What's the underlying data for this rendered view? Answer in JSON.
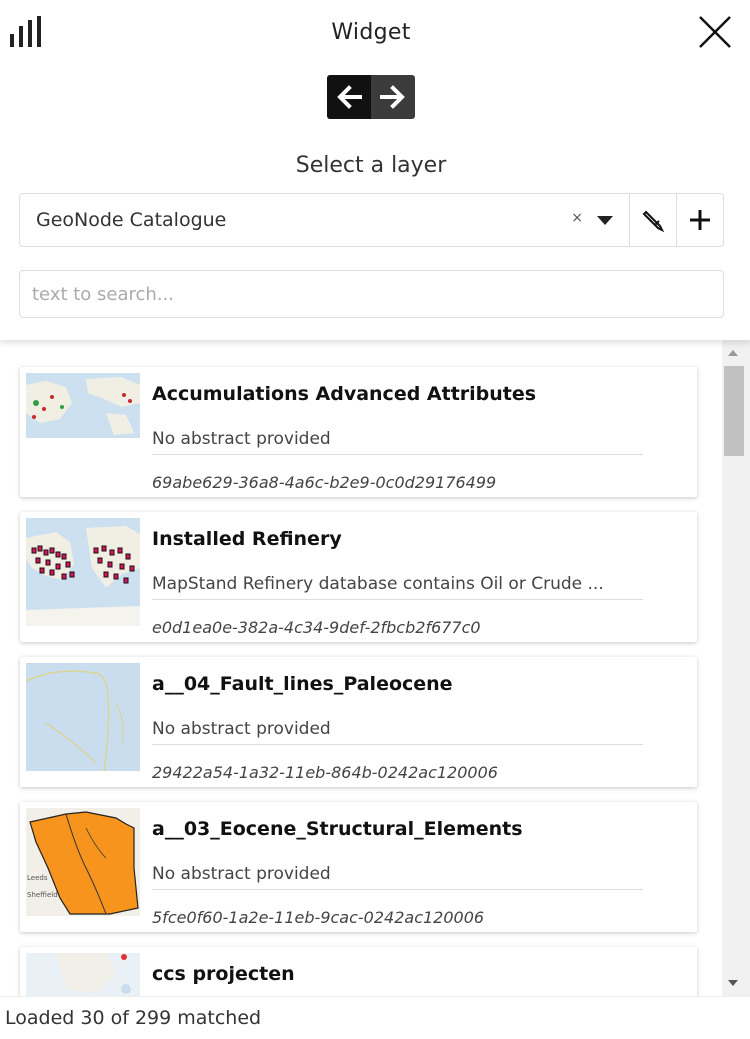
{
  "header": {
    "title": "Widget",
    "select_label": "Select a layer"
  },
  "layer_select": {
    "value": "GeoNode Catalogue",
    "clear_symbol": "×"
  },
  "search": {
    "placeholder": "text to search..."
  },
  "icons": {
    "chart": "bar-chart-icon",
    "close": "close-icon",
    "back": "arrow-left-icon",
    "forward": "arrow-right-icon",
    "edit": "pencil-icon",
    "add": "plus-icon"
  },
  "results": [
    {
      "title": "Accumulations Advanced Attributes",
      "abstract": "No abstract provided",
      "uuid": "69abe629-36a8-4a6c-b2e9-0c0d29176499"
    },
    {
      "title": "Installed Refinery",
      "abstract": "MapStand Refinery database contains Oil or Crude ...",
      "uuid": "e0d1ea0e-382a-4c34-9def-2fbcb2f677c0"
    },
    {
      "title": "a__04_Fault_lines_Paleocene",
      "abstract": "No abstract provided",
      "uuid": "29422a54-1a32-11eb-864b-0242ac120006"
    },
    {
      "title": "a__03_Eocene_Structural_Elements",
      "abstract": "No abstract provided",
      "uuid": "5fce0f60-1a2e-11eb-9cac-0242ac120006"
    },
    {
      "title": "ccs projecten",
      "abstract": "",
      "uuid": ""
    }
  ],
  "thumb_labels": [
    "Leeds",
    "Sheffield"
  ],
  "footer": {
    "status": "Loaded 30 of 299 matched"
  },
  "colors": {
    "nav_back": "#111111",
    "nav_forward": "#3b3b3b",
    "thumb_orange": "#f7941d",
    "refinery_marker": "#e0115f"
  }
}
